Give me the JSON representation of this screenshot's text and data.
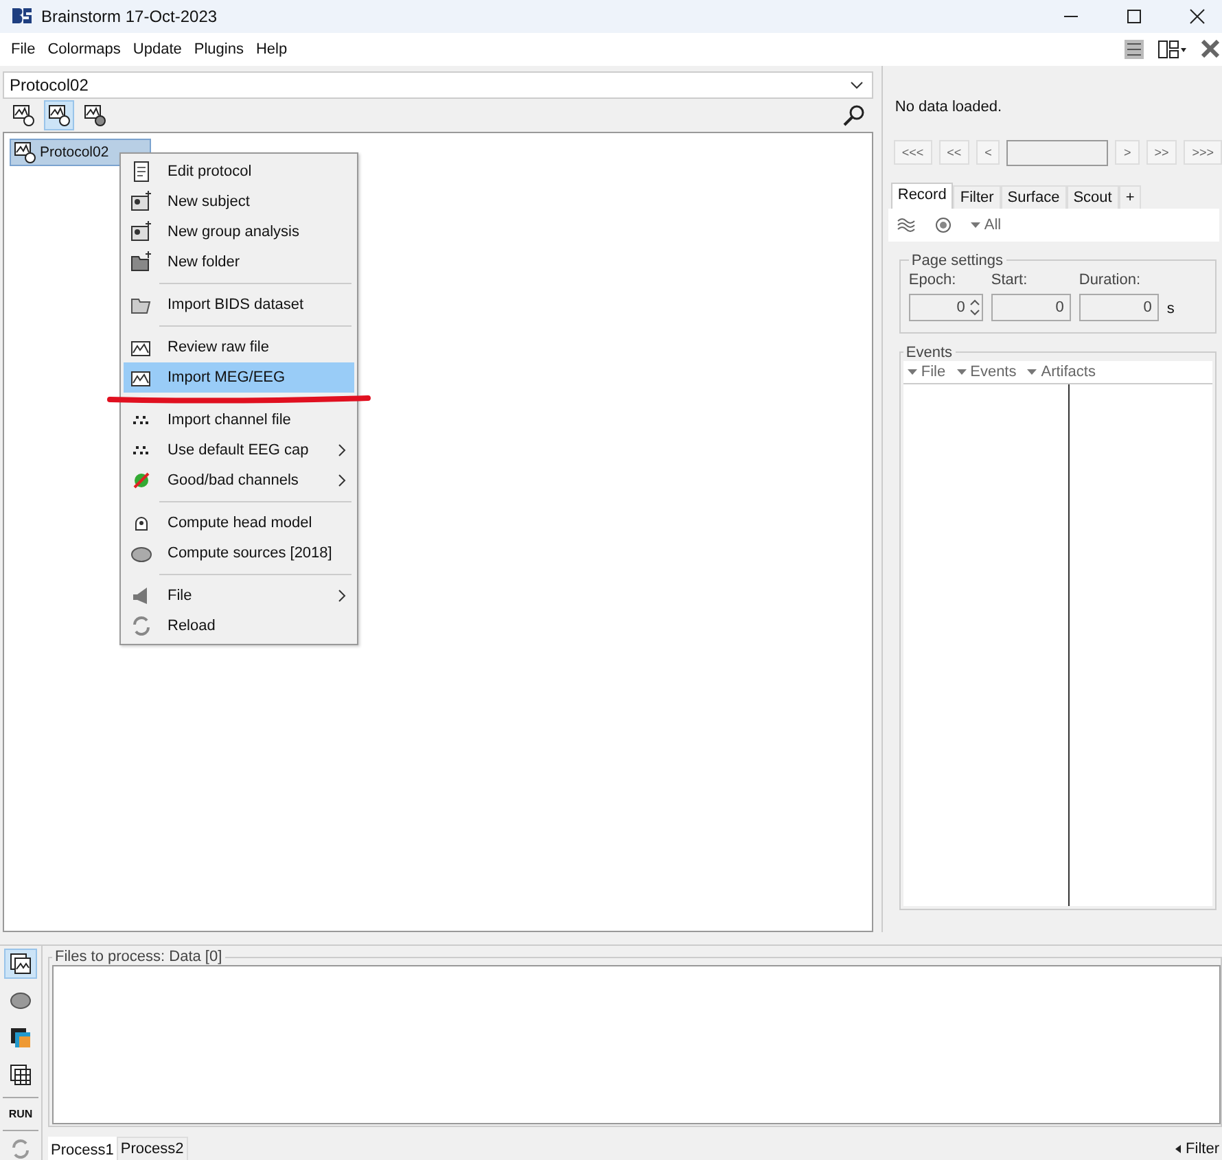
{
  "window": {
    "title": "Brainstorm 17-Oct-2023"
  },
  "menu_bar": [
    "File",
    "Colormaps",
    "Update",
    "Plugins",
    "Help"
  ],
  "protocol_select": {
    "value": "Protocol02"
  },
  "view_toolbar": [
    {
      "selected": false
    },
    {
      "selected": true
    },
    {
      "selected": false
    }
  ],
  "tree": {
    "items": [
      {
        "label": "Protocol02",
        "selected": true
      }
    ]
  },
  "context_menu": [
    {
      "kind": "item",
      "label": "Edit protocol",
      "submenu": false,
      "selected": false,
      "underlined": false
    },
    {
      "kind": "item",
      "label": "New subject",
      "submenu": false,
      "selected": false,
      "underlined": false
    },
    {
      "kind": "item",
      "label": "New group analysis",
      "submenu": false,
      "selected": false,
      "underlined": false
    },
    {
      "kind": "item",
      "label": "New folder",
      "submenu": false,
      "selected": false,
      "underlined": false
    },
    {
      "kind": "separator"
    },
    {
      "kind": "item",
      "label": "Import BIDS dataset",
      "submenu": false,
      "selected": false,
      "underlined": false
    },
    {
      "kind": "separator"
    },
    {
      "kind": "item",
      "label": "Review raw file",
      "submenu": false,
      "selected": false,
      "underlined": false
    },
    {
      "kind": "item",
      "label": "Import MEG/EEG",
      "submenu": false,
      "selected": true,
      "underlined": true
    },
    {
      "kind": "separator"
    },
    {
      "kind": "item",
      "label": "Import channel file",
      "submenu": false,
      "selected": false,
      "underlined": false
    },
    {
      "kind": "item",
      "label": "Use default EEG cap",
      "submenu": true,
      "selected": false,
      "underlined": false
    },
    {
      "kind": "item",
      "label": "Good/bad channels",
      "submenu": true,
      "selected": false,
      "underlined": false
    },
    {
      "kind": "separator"
    },
    {
      "kind": "item",
      "label": "Compute head model",
      "submenu": false,
      "selected": false,
      "underlined": false
    },
    {
      "kind": "item",
      "label": "Compute sources [2018]",
      "submenu": false,
      "selected": false,
      "underlined": false
    },
    {
      "kind": "separator"
    },
    {
      "kind": "item",
      "label": "File",
      "submenu": true,
      "selected": false,
      "underlined": false
    },
    {
      "kind": "item",
      "label": "Reload",
      "submenu": false,
      "selected": false,
      "underlined": false
    }
  ],
  "right_panel": {
    "status": "No data loaded.",
    "nav_buttons": [
      "<<<",
      "<<",
      "<",
      ">",
      ">>",
      ">>>"
    ],
    "tabs": [
      {
        "label": "Record",
        "selected": true
      },
      {
        "label": "Filter",
        "selected": false
      },
      {
        "label": "Surface",
        "selected": false
      },
      {
        "label": "Scout",
        "selected": false
      },
      {
        "label": "+",
        "selected": false
      }
    ],
    "toolbar_dropdown": "All",
    "page_settings": {
      "title": "Page settings",
      "fields": [
        {
          "label": "Epoch:",
          "value": "0"
        },
        {
          "label": "Start:",
          "value": "0"
        },
        {
          "label": "Duration:",
          "value": "0"
        }
      ],
      "unit": "s"
    },
    "events": {
      "title": "Events",
      "menus": [
        "File",
        "Events",
        "Artifacts"
      ]
    }
  },
  "process_panel": {
    "title": "Files to process: Data [0]",
    "run_label": "RUN",
    "side_toolbar": [
      {
        "selected": true
      },
      {
        "selected": false
      },
      {
        "selected": false
      },
      {
        "selected": false
      }
    ],
    "tabs": [
      {
        "label": "Process1",
        "selected": true
      },
      {
        "label": "Process2",
        "selected": false
      }
    ],
    "filter_label": "Filter"
  }
}
